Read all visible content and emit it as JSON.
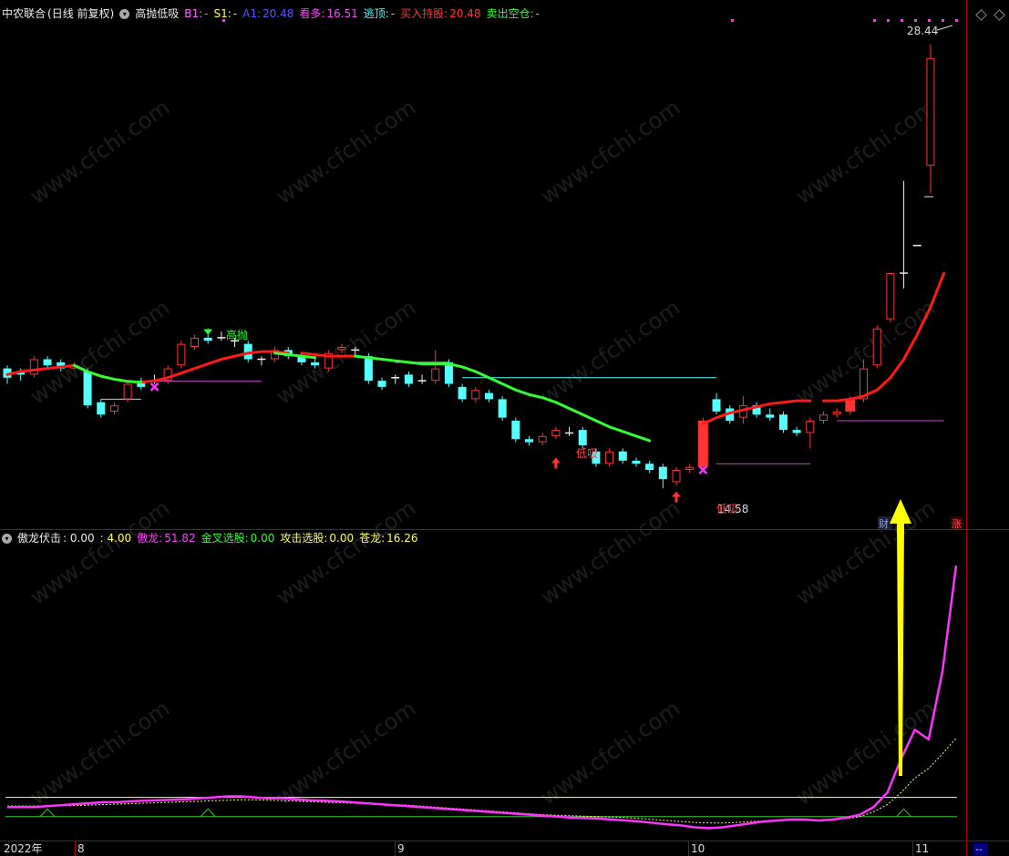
{
  "upper_header": {
    "stock": "中农联合",
    "period": "(日线 前复权)",
    "indicator": "高抛低吸",
    "b1_label": "B1:",
    "b1_value": "-",
    "s1_label": "S1:",
    "s1_value": "-",
    "a1_label": "A1:",
    "a1_value": "20.48",
    "kanduo_label": "看多:",
    "kanduo_value": "16.51",
    "taoding_label": "逃顶:",
    "taoding_value": "-",
    "buy_label": "买入持股:",
    "buy_value": "20.48",
    "sell_label": "卖出空仓:",
    "sell_value": "-"
  },
  "lower_header": {
    "indicator": "傲龙伏击",
    "v1": ": 0.00",
    "v2": ": 4.00",
    "aolong_label": "傲龙:",
    "aolong_value": "51.82",
    "jincha_label": "金叉选股:",
    "jincha_value": "0.00",
    "gongji_label": "攻击选股:",
    "gongji_value": "0.00",
    "canglong_label": "苍龙:",
    "canglong_value": "16.26"
  },
  "annotations": {
    "high_price": "28.44",
    "gaopao": "高抛",
    "dixi": "低吸",
    "dixi2": "低吸",
    "low_price": "14.58",
    "cai": "财",
    "zhang": "涨"
  },
  "x_axis": {
    "year": "2022年",
    "m8": "8",
    "m9": "9",
    "m10": "10",
    "m11": "11",
    "end": "--"
  },
  "watermark": "www.cfchi.com",
  "colors": {
    "up": "#ff3333",
    "down": "#54ffff",
    "ma_red": "#ff1a1a",
    "ma_green": "#33ff33",
    "aolong": "#ff33ff",
    "canglong": "#ffff66",
    "hline_yellow": "#ffff99",
    "hline_green": "#33cc33",
    "separator": "#b00000",
    "arrow": "#ffff00"
  },
  "chart_data": {
    "type": "candlestick",
    "y_range": [
      13.0,
      29.0
    ],
    "candles": [
      {
        "o": 17.9,
        "c": 17.6,
        "h": 18.0,
        "l": 17.4
      },
      {
        "o": 17.8,
        "c": 17.7,
        "h": 17.9,
        "l": 17.5
      },
      {
        "o": 17.7,
        "c": 18.2,
        "h": 18.3,
        "l": 17.6
      },
      {
        "o": 18.2,
        "c": 18.0,
        "h": 18.3,
        "l": 17.9
      },
      {
        "o": 18.1,
        "c": 17.9,
        "h": 18.2,
        "l": 17.8
      },
      {
        "o": 17.9,
        "c": 18.0,
        "h": 18.1,
        "l": 17.9
      },
      {
        "o": 17.8,
        "c": 16.7,
        "h": 17.9,
        "l": 16.6
      },
      {
        "o": 16.8,
        "c": 16.4,
        "h": 16.9,
        "l": 16.3
      },
      {
        "o": 16.5,
        "c": 16.7,
        "h": 16.8,
        "l": 16.4
      },
      {
        "o": 16.9,
        "c": 17.4,
        "h": 17.5,
        "l": 16.8
      },
      {
        "o": 17.5,
        "c": 17.3,
        "h": 17.6,
        "l": 17.2
      },
      {
        "o": 17.5,
        "c": 17.5,
        "h": 17.7,
        "l": 17.4
      },
      {
        "o": 17.5,
        "c": 17.9,
        "h": 18.0,
        "l": 17.4
      },
      {
        "o": 18.0,
        "c": 18.7,
        "h": 18.8,
        "l": 17.9
      },
      {
        "o": 18.6,
        "c": 18.9,
        "h": 19.0,
        "l": 18.5
      },
      {
        "o": 18.9,
        "c": 18.8,
        "h": 19.2,
        "l": 18.7
      },
      {
        "o": 18.9,
        "c": 18.9,
        "h": 19.1,
        "l": 18.8
      },
      {
        "o": 18.8,
        "c": 18.8,
        "h": 18.9,
        "l": 18.6
      },
      {
        "o": 18.7,
        "c": 18.2,
        "h": 18.8,
        "l": 18.1
      },
      {
        "o": 18.2,
        "c": 18.2,
        "h": 18.3,
        "l": 18.0
      },
      {
        "o": 18.2,
        "c": 18.5,
        "h": 18.6,
        "l": 18.1
      },
      {
        "o": 18.5,
        "c": 18.3,
        "h": 18.6,
        "l": 18.2
      },
      {
        "o": 18.3,
        "c": 18.1,
        "h": 18.4,
        "l": 18.0
      },
      {
        "o": 18.1,
        "c": 18.0,
        "h": 18.3,
        "l": 17.9
      },
      {
        "o": 17.9,
        "c": 18.4,
        "h": 18.5,
        "l": 17.8
      },
      {
        "o": 18.5,
        "c": 18.6,
        "h": 18.7,
        "l": 18.4
      },
      {
        "o": 18.5,
        "c": 18.5,
        "h": 18.6,
        "l": 18.3
      },
      {
        "o": 18.3,
        "c": 17.5,
        "h": 18.4,
        "l": 17.4
      },
      {
        "o": 17.5,
        "c": 17.3,
        "h": 17.6,
        "l": 17.2
      },
      {
        "o": 17.6,
        "c": 17.6,
        "h": 17.7,
        "l": 17.4
      },
      {
        "o": 17.7,
        "c": 17.4,
        "h": 17.8,
        "l": 17.3
      },
      {
        "o": 17.5,
        "c": 17.5,
        "h": 17.7,
        "l": 17.4
      },
      {
        "o": 17.5,
        "c": 17.9,
        "h": 18.5,
        "l": 17.4
      },
      {
        "o": 18.1,
        "c": 17.4,
        "h": 18.2,
        "l": 17.3
      },
      {
        "o": 17.3,
        "c": 16.9,
        "h": 17.4,
        "l": 16.8
      },
      {
        "o": 16.9,
        "c": 17.2,
        "h": 17.3,
        "l": 16.8
      },
      {
        "o": 17.1,
        "c": 16.9,
        "h": 17.2,
        "l": 16.8
      },
      {
        "o": 16.9,
        "c": 16.3,
        "h": 17.0,
        "l": 16.2
      },
      {
        "o": 16.2,
        "c": 15.6,
        "h": 16.3,
        "l": 15.5
      },
      {
        "o": 15.6,
        "c": 15.5,
        "h": 15.7,
        "l": 15.4
      },
      {
        "o": 15.5,
        "c": 15.7,
        "h": 15.8,
        "l": 15.4
      },
      {
        "o": 15.7,
        "c": 15.9,
        "h": 16.0,
        "l": 15.6
      },
      {
        "o": 15.8,
        "c": 15.8,
        "h": 16.0,
        "l": 15.7
      },
      {
        "o": 15.9,
        "c": 15.4,
        "h": 16.0,
        "l": 15.3
      },
      {
        "o": 15.2,
        "c": 14.8,
        "h": 15.3,
        "l": 14.7
      },
      {
        "o": 14.8,
        "c": 15.2,
        "h": 15.3,
        "l": 14.7
      },
      {
        "o": 15.2,
        "c": 14.9,
        "h": 15.3,
        "l": 14.8
      },
      {
        "o": 14.9,
        "c": 14.8,
        "h": 15.0,
        "l": 14.7
      },
      {
        "o": 14.8,
        "c": 14.6,
        "h": 14.9,
        "l": 14.5
      },
      {
        "o": 14.7,
        "c": 14.3,
        "h": 14.8,
        "l": 14.0
      },
      {
        "o": 14.2,
        "c": 14.6,
        "h": 14.7,
        "l": 14.1
      },
      {
        "o": 14.6,
        "c": 14.7,
        "h": 14.8,
        "l": 14.5
      },
      {
        "o": 14.7,
        "c": 16.2,
        "h": 16.3,
        "l": 14.6
      },
      {
        "o": 16.9,
        "c": 16.5,
        "h": 17.1,
        "l": 16.4
      },
      {
        "o": 16.6,
        "c": 16.2,
        "h": 16.7,
        "l": 16.1
      },
      {
        "o": 16.3,
        "c": 16.7,
        "h": 17.0,
        "l": 16.1
      },
      {
        "o": 16.7,
        "c": 16.4,
        "h": 16.8,
        "l": 16.3
      },
      {
        "o": 16.4,
        "c": 16.3,
        "h": 16.6,
        "l": 16.2
      },
      {
        "o": 16.4,
        "c": 15.9,
        "h": 16.5,
        "l": 15.8
      },
      {
        "o": 15.9,
        "c": 15.8,
        "h": 16.0,
        "l": 15.7
      },
      {
        "o": 15.8,
        "c": 16.2,
        "h": 16.3,
        "l": 15.3
      },
      {
        "o": 16.2,
        "c": 16.4,
        "h": 16.5,
        "l": 16.1
      },
      {
        "o": 16.4,
        "c": 16.5,
        "h": 16.6,
        "l": 16.3
      },
      {
        "o": 16.5,
        "c": 16.9,
        "h": 17.0,
        "l": 16.4
      },
      {
        "o": 16.9,
        "c": 17.9,
        "h": 18.2,
        "l": 16.8
      },
      {
        "o": 18.0,
        "c": 19.2,
        "h": 19.3,
        "l": 17.9
      },
      {
        "o": 19.5,
        "c": 21.0,
        "h": 21.0,
        "l": 19.4
      },
      {
        "o": 21.0,
        "c": 21.0,
        "h": 24.0,
        "l": 20.5
      },
      {
        "o": 21.9,
        "c": 21.9,
        "h": 21.9,
        "l": 21.9
      },
      {
        "o": 24.5,
        "c": 28.0,
        "h": 28.44,
        "l": 23.6
      }
    ],
    "ma_red_segments": [
      {
        "start": 0,
        "values": [
          17.7,
          17.8,
          17.85,
          17.9,
          17.95,
          18.0
        ]
      },
      {
        "start": 10,
        "values": [
          17.45,
          17.5,
          17.6,
          17.75,
          17.9,
          18.05,
          18.2,
          18.3,
          18.4,
          18.45,
          18.45,
          18.4
        ]
      },
      {
        "start": 22,
        "values": [
          18.4,
          18.35,
          18.3,
          18.3,
          18.3
        ]
      },
      {
        "start": 52,
        "values": [
          16.1,
          16.3,
          16.45,
          16.55,
          16.65,
          16.75,
          16.8,
          16.85,
          16.85
        ]
      },
      {
        "start": 61,
        "values": [
          16.85,
          16.85,
          16.9,
          17.0,
          17.2,
          17.6,
          18.2,
          19.0,
          19.9,
          21.0
        ]
      }
    ],
    "ma_green_segments": [
      {
        "start": 5,
        "values": [
          18.0,
          17.8,
          17.65,
          17.55,
          17.48,
          17.45
        ]
      },
      {
        "start": 20,
        "values": [
          18.4,
          18.35,
          18.3,
          18.25
        ]
      },
      {
        "start": 26,
        "values": [
          18.3,
          18.25,
          18.2,
          18.15,
          18.1,
          18.05,
          18.05,
          18.05,
          17.95,
          17.8,
          17.6,
          17.4,
          17.2,
          17.05,
          16.95,
          16.8,
          16.6,
          16.4,
          16.2,
          16.0,
          15.85,
          15.7,
          15.55
        ]
      }
    ],
    "aolong": [
      2,
      2,
      2,
      2.2,
      2.4,
      2.6,
      2.8,
      3,
      3,
      3.2,
      3.3,
      3.4,
      3.5,
      3.6,
      3.8,
      4,
      4.2,
      4.2,
      4,
      3.8,
      3.8,
      3.6,
      3.4,
      3.3,
      3.2,
      3,
      2.8,
      2.6,
      2.4,
      2.2,
      2,
      1.8,
      1.6,
      1.4,
      1.2,
      1,
      0.8,
      0.6,
      0.4,
      0.2,
      0,
      -0.2,
      -0.3,
      -0.4,
      -0.6,
      -0.8,
      -1,
      -1.3,
      -1.6,
      -1.8,
      -2.2,
      -2.4,
      -2.2,
      -1.8,
      -1.4,
      -1,
      -0.8,
      -0.6,
      -0.6,
      -0.8,
      -0.6,
      -0.2,
      0.4,
      2,
      5,
      12,
      18,
      16,
      30,
      52
    ],
    "canglong": [
      2.2,
      2.2,
      2.2,
      2.2,
      2.3,
      2.3,
      2.4,
      2.5,
      2.6,
      2.7,
      2.8,
      2.9,
      3,
      3.1,
      3.2,
      3.3,
      3.4,
      3.5,
      3.5,
      3.4,
      3.3,
      3.2,
      3.1,
      3,
      2.9,
      2.8,
      2.7,
      2.6,
      2.5,
      2.4,
      2.2,
      2,
      1.8,
      1.6,
      1.4,
      1.2,
      1,
      0.8,
      0.6,
      0.4,
      0.3,
      0.2,
      0.1,
      0,
      -0.1,
      -0.2,
      -0.4,
      -0.6,
      -0.8,
      -1,
      -1.2,
      -1.3,
      -1.3,
      -1.2,
      -1,
      -0.9,
      -0.8,
      -0.7,
      -0.7,
      -0.7,
      -0.6,
      -0.4,
      0,
      1,
      2.5,
      5,
      8,
      10,
      13,
      16.26
    ],
    "lower_y_range": [
      -4,
      56
    ],
    "hlines": [
      4.0,
      0.0
    ]
  }
}
